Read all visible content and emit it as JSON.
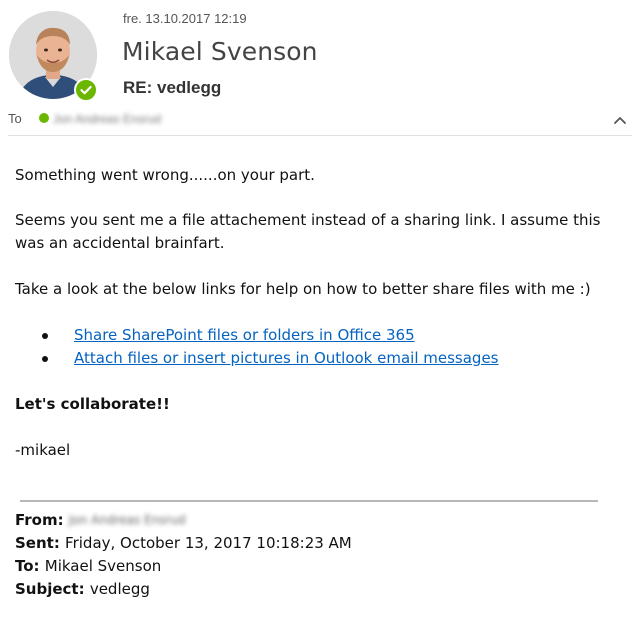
{
  "header": {
    "date": "fre. 13.10.2017 12:19",
    "sender": "Mikael Svenson",
    "subject": "RE: vedlegg",
    "to_label": "To",
    "to_name": "Jon Andreas Ensrud",
    "presence_color": "#6bb700",
    "avatar_icon": "sender-avatar",
    "collapse_icon": "chevron-up-icon"
  },
  "body": {
    "p1": "Something went wrong......on your part.",
    "p2": "Seems you sent me a file attachement instead of a sharing link. I assume this was an accidental brainfart.",
    "p3": "Take a look at the below links for help on how to better share files with me :)",
    "links": [
      {
        "text": "Share SharePoint files or folders in Office 365"
      },
      {
        "text": "Attach files or insert pictures in Outlook email messages"
      }
    ],
    "p4": "Let's collaborate!!",
    "p5": "-mikael",
    "link_color": "#0563c1"
  },
  "quoted": {
    "from_label": "From:",
    "from_value": "Jon Andreas Ensrud",
    "sent_label": "Sent:",
    "sent_value": "Friday, October 13, 2017 10:18:23 AM",
    "to_label": "To:",
    "to_value": "Mikael Svenson",
    "subject_label": "Subject:",
    "subject_value": "vedlegg"
  }
}
